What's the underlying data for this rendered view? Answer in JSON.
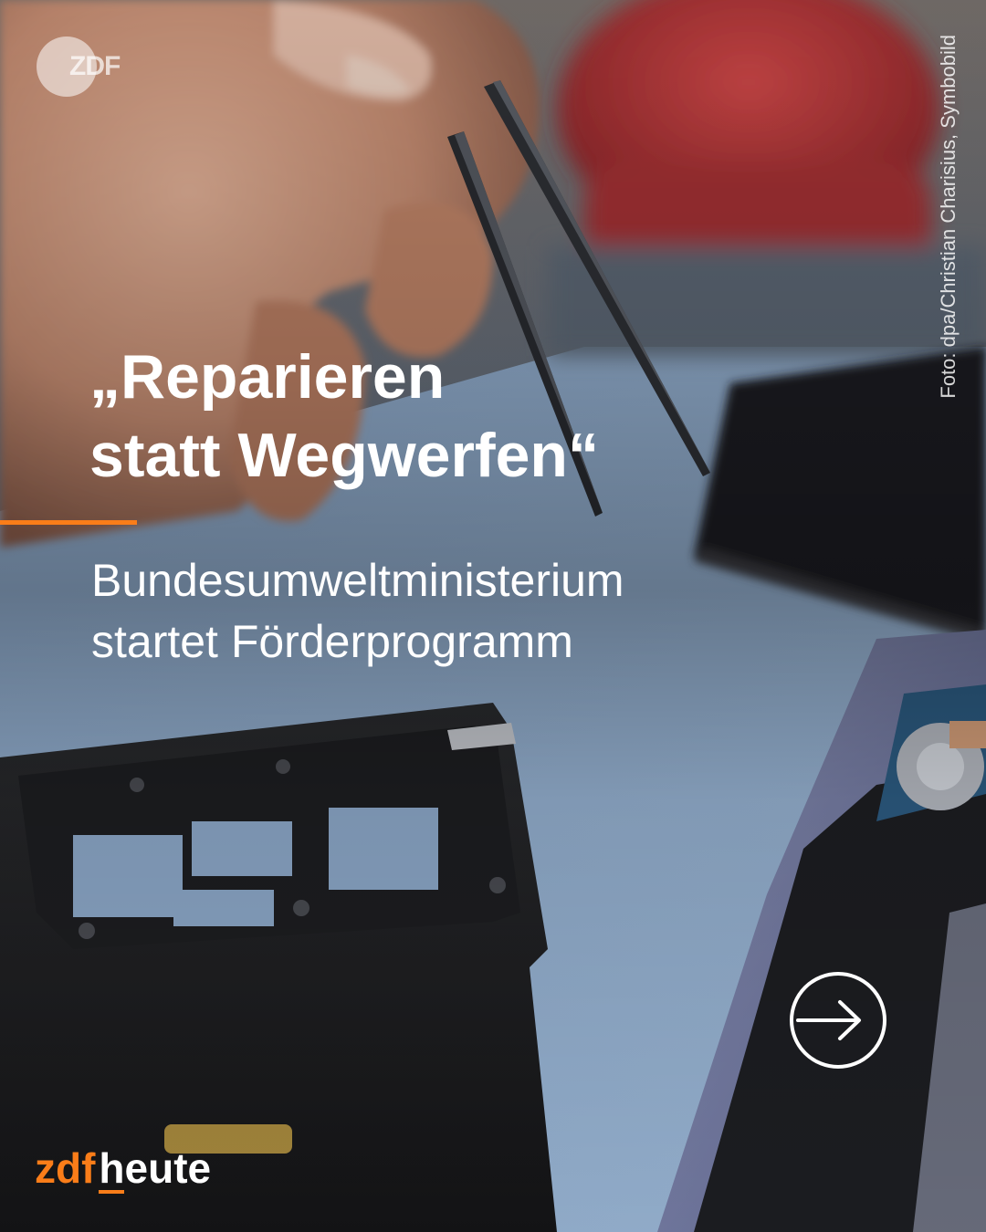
{
  "logo_top": {
    "text": "ZDF"
  },
  "photo_credit": "Foto: dpa/Christian Charisius, Symbobild",
  "headline": "„Reparieren\nstatt Wegwerfen“",
  "subline": "Bundesumweltministerium\nstartet Förderprogramm",
  "next_button": {
    "icon": "arrow-right-circle-icon"
  },
  "brand": {
    "part1": "zdf",
    "part2": "heute"
  },
  "colors": {
    "accent": "#fa7d19",
    "text": "#ffffff"
  }
}
